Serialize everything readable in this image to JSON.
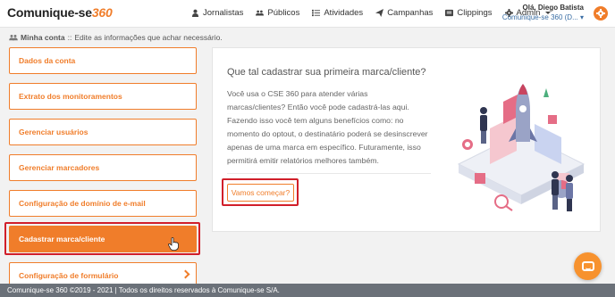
{
  "header": {
    "logo": {
      "text": "Comunique-se",
      "num": "360"
    },
    "nav": [
      {
        "label": "Jornalistas",
        "icon": "user-icon"
      },
      {
        "label": "Públicos",
        "icon": "group-icon"
      },
      {
        "label": "Atividades",
        "icon": "list-icon"
      },
      {
        "label": "Campanhas",
        "icon": "send-icon"
      },
      {
        "label": "Clippings",
        "icon": "clipping-icon"
      },
      {
        "label": "Admin",
        "icon": "gear-icon"
      }
    ],
    "user_greeting": "Olá, Diego Batista",
    "account": "Comunique-se 360 (D..."
  },
  "breadcrumb": {
    "section": "Minha conta",
    "separator": "::",
    "text": "Edite as informações que achar necessário."
  },
  "menu": [
    {
      "label": "Dados da conta"
    },
    {
      "label": "Extrato dos monitoramentos"
    },
    {
      "label": "Gerenciar usuários"
    },
    {
      "label": "Gerenciar marcadores"
    },
    {
      "label": "Configuração de domínio de e-mail"
    },
    {
      "label": "Cadastrar marca/cliente"
    },
    {
      "label": "Configuração de formulário"
    }
  ],
  "panel": {
    "title": "Que tal cadastrar sua primeira marca/cliente?",
    "body": "Você usa o CSE 360 para atender várias marcas/clientes? Então você pode cadastrá-las aqui. Fazendo isso você tem alguns benefícios como: no momento do optout, o destinatário poderá se desinscrever apenas de uma marca em específico. Futuramente, isso permitirá emitir relatórios melhores também.",
    "start_button": "Vamos começar?"
  },
  "footer": "Comunique-se 360 ©2019 - 2021 | Todos os direitos reservados à Comunique-se S/A.",
  "colors": {
    "accent": "#f07d2a",
    "highlight": "#d11f2a",
    "footer": "#6b7179"
  }
}
